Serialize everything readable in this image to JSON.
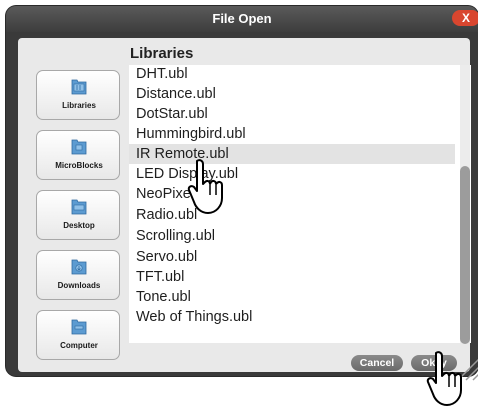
{
  "window": {
    "title": "File Open",
    "close_glyph": "X"
  },
  "folder": {
    "label": "Libraries"
  },
  "shortcuts": [
    {
      "label": "Libraries",
      "icon": "libraries-folder-icon"
    },
    {
      "label": "MicroBlocks",
      "icon": "microblocks-folder-icon"
    },
    {
      "label": "Desktop",
      "icon": "desktop-folder-icon"
    },
    {
      "label": "Downloads",
      "icon": "downloads-folder-icon"
    },
    {
      "label": "Computer",
      "icon": "computer-folder-icon"
    }
  ],
  "files": [
    "DHT.ubl",
    "Distance.ubl",
    "DotStar.ubl",
    "Hummingbird.ubl",
    "IR Remote.ubl",
    "LED Display.ubl",
    "NeoPixel.ubl",
    "Radio.ubl",
    "Scrolling.ubl",
    "Servo.ubl",
    "TFT.ubl",
    "Tone.ubl",
    "Web of Things.ubl"
  ],
  "selected_file": "IR Remote.ubl",
  "buttons": {
    "cancel": "Cancel",
    "okay": "Okay"
  },
  "colors": {
    "title_bar": "#3d3d3d",
    "close_button": "#d9462f",
    "folder_icon": "#5c9bd1",
    "selection": "#e3e3e3"
  }
}
